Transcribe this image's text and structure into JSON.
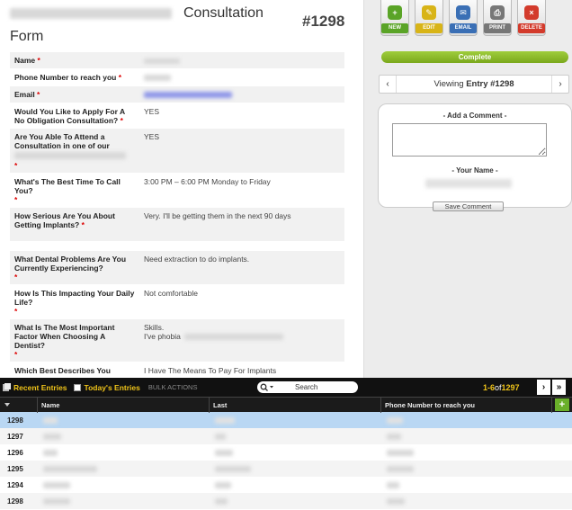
{
  "form": {
    "title_tail": "Consultation",
    "title_line2": "Form",
    "entry_id": "#1298",
    "fields": [
      {
        "label": "Name",
        "required": true,
        "value": ""
      },
      {
        "label": "Phone Number to reach you",
        "required": true,
        "value": ""
      },
      {
        "label": "Email",
        "required": true,
        "value": ""
      },
      {
        "label": "Would You Like to Apply For A No Obligation Consultation?",
        "required": true,
        "value": "YES"
      },
      {
        "label": "Are You Able To Attend a Consultation in one of our",
        "required": true,
        "value": "YES"
      },
      {
        "label": "What's The Best Time To Call You?",
        "required": true,
        "value": "3:00 PM – 6:00 PM Monday to Friday"
      },
      {
        "label": "How Serious Are You About Getting Implants?",
        "required": true,
        "value": "Very. I'll be getting them in the next 90 days"
      },
      {
        "label": "",
        "required": false,
        "value": ""
      },
      {
        "label": "What Dental Problems Are You Currently Experiencing?",
        "required": true,
        "value": "Need extraction to do implants."
      },
      {
        "label": "How Is This Impacting Your Daily Life?",
        "required": true,
        "value": "Not comfortable"
      },
      {
        "label": "What Is The Most Important Factor When Choosing A Dentist?",
        "required": true,
        "value": "Skills.",
        "value2": "I've phobia"
      },
      {
        "label": "Which Best Describes You",
        "required": false,
        "value": "I Have The Means To Pay For Implants"
      }
    ]
  },
  "actions": [
    {
      "label": "NEW",
      "icon": "new-icon",
      "color": "#5aa427"
    },
    {
      "label": "EDIT",
      "icon": "edit-icon",
      "color": "#d8b417"
    },
    {
      "label": "EMAIL",
      "icon": "email-icon",
      "color": "#3a6fb5"
    },
    {
      "label": "PRINT",
      "icon": "print-icon",
      "color": "#777777"
    },
    {
      "label": "DELETE",
      "icon": "delete-icon",
      "color": "#d33b2c"
    }
  ],
  "complete_label": "Complete",
  "viewing": {
    "prefix": "Viewing ",
    "entry": "Entry #1298",
    "prev": "‹",
    "next": "›"
  },
  "comment": {
    "add_label": "- Add a Comment -",
    "name_label": "- Your Name -",
    "save_label": "Save Comment"
  },
  "list": {
    "recent_tab": "Recent Entries",
    "today_tab": "Today's Entries",
    "bulk": "BULK ACTIONS",
    "search_placeholder": "Search",
    "range": "1-6",
    "of": " of ",
    "total": "1297",
    "columns": [
      "Name",
      "Last",
      "Phone Number to reach you"
    ],
    "add": "+",
    "rows": [
      {
        "id": "1298",
        "selected": true
      },
      {
        "id": "1297",
        "selected": false
      },
      {
        "id": "1296",
        "selected": false
      },
      {
        "id": "1295",
        "selected": false
      },
      {
        "id": "1294",
        "selected": false
      },
      {
        "id": "1298",
        "selected": false
      }
    ]
  }
}
